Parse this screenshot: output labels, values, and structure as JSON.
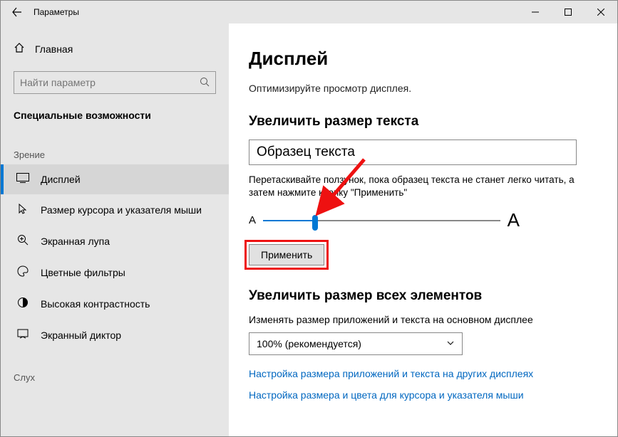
{
  "window": {
    "title": "Параметры"
  },
  "sidebar": {
    "home": "Главная",
    "search_placeholder": "Найти параметр",
    "section": "Специальные возможности",
    "group_vision": "Зрение",
    "group_hearing": "Слух",
    "items": [
      {
        "label": "Дисплей"
      },
      {
        "label": "Размер курсора и указателя мыши"
      },
      {
        "label": "Экранная лупа"
      },
      {
        "label": "Цветные фильтры"
      },
      {
        "label": "Высокая контрастность"
      },
      {
        "label": "Экранный диктор"
      }
    ]
  },
  "content": {
    "h1": "Дисплей",
    "subtitle": "Оптимизируйте просмотр дисплея.",
    "text_size_heading": "Увеличить размер текста",
    "sample_text": "Образец текста",
    "slider_hint": "Перетаскивайте ползунок, пока образец текста не станет легко читать, а затем нажмите кнопку \"Применить\"",
    "slider_small": "A",
    "slider_large": "A",
    "slider_value_percent": 22,
    "apply_label": "Применить",
    "all_heading": "Увеличить размер всех элементов",
    "scale_label": "Изменять размер приложений и текста на основном дисплее",
    "scale_value": "100% (рекомендуется)",
    "link1": "Настройка размера приложений и текста на других дисплеях",
    "link2": "Настройка размера и цвета для курсора и указателя мыши"
  }
}
